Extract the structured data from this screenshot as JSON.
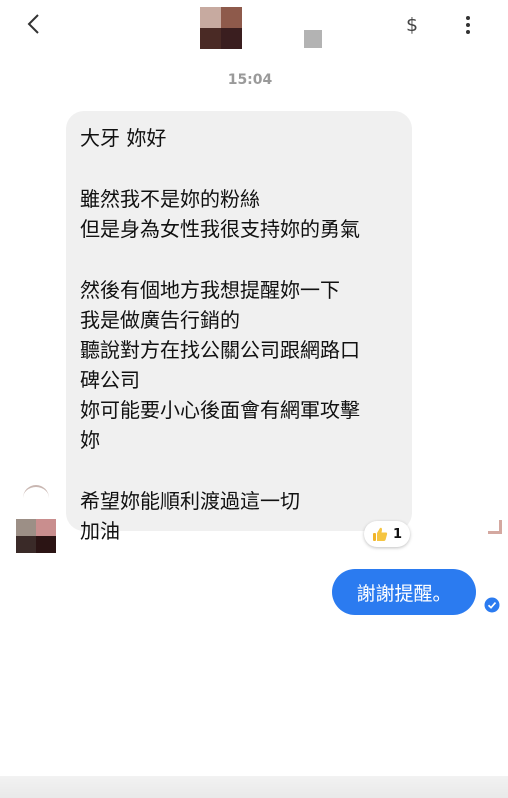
{
  "header": {
    "back_icon": "chevron-left-icon",
    "payment_symbol": "$",
    "more_icon": "vertical-dots-icon",
    "avatar_colors": [
      "#c7aaa0",
      "#8e5a4b",
      "#4a2a25",
      "#3a1e1f"
    ]
  },
  "timestamp": "15:04",
  "incoming_message": {
    "lines": [
      "大牙 妳好",
      "",
      "雖然我不是妳的粉絲",
      "但是身為女性我很支持妳的勇氣",
      "",
      "然後有個地方我想提醒妳一下",
      "我是做廣告行銷的",
      "聽說對方在找公關公司跟網路口",
      "碑公司",
      "妳可能要小心後面會有網軍攻擊",
      "妳",
      "",
      "希望妳能順利渡過這一切",
      "加油"
    ],
    "reaction": {
      "icon": "thumbs-up-icon",
      "count": "1"
    },
    "sender_avatar_colors": [
      "#9c8f86",
      "#c98e8e",
      "#3a2a28",
      "#2b1414"
    ]
  },
  "outgoing_message": {
    "text": "謝謝提醒。",
    "status_icon": "seen-check-icon"
  },
  "colors": {
    "outgoing_bubble": "#2b7bf0",
    "incoming_bubble": "#f0f0f0",
    "timestamp": "#9a9a9a"
  }
}
